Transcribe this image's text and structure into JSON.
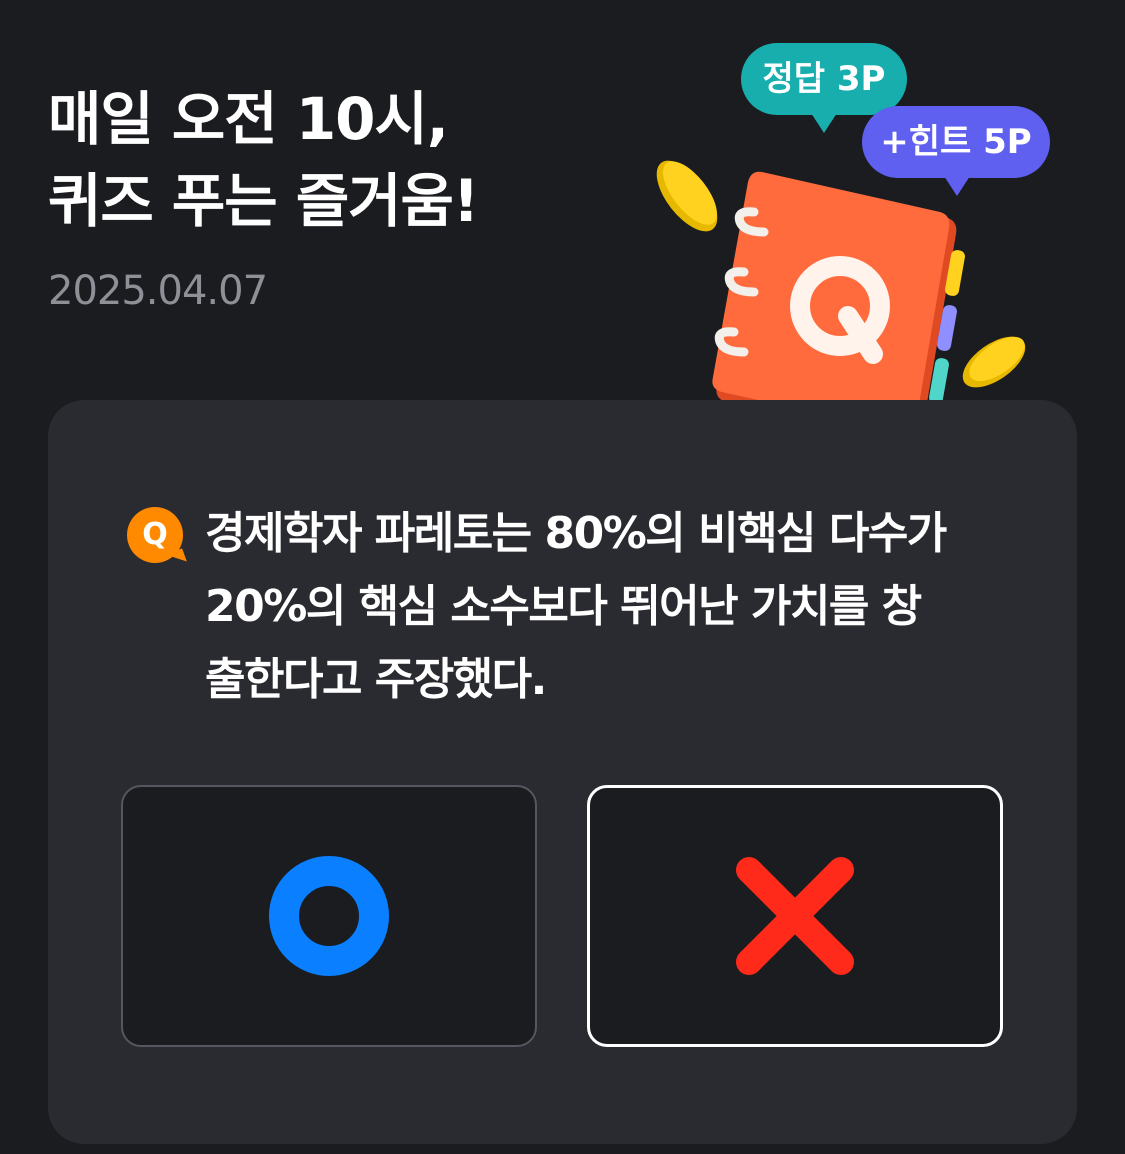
{
  "header": {
    "title_line1": "매일 오전 10시,",
    "title_line2": "퀴즈 푸는 즐거움!",
    "date": "2025.04.07"
  },
  "bubbles": {
    "answer": "정답 3P",
    "hint": "+힌트 5P"
  },
  "illustration": {
    "icon": "quiz-notebook-icon",
    "badge_letter": "Q"
  },
  "quiz": {
    "badge": "Q",
    "question_lines": [
      "경제학자 파레토는 80%의 비핵심 다수가",
      "20%의 핵심 소수보다 뛰어난 가치를 창",
      "출한다고 주장했다."
    ]
  },
  "choices": {
    "true_icon": "circle-o-icon",
    "false_icon": "x-mark-icon"
  },
  "colors": {
    "background": "#1b1c20",
    "card": "#2a2b31",
    "answer_bubble": "#19aeae",
    "hint_bubble": "#5f5ff0",
    "q_badge": "#ff8a00",
    "o_mark": "#0a7fff",
    "x_mark": "#ff2a1a",
    "notebook": "#ff6b3d"
  }
}
